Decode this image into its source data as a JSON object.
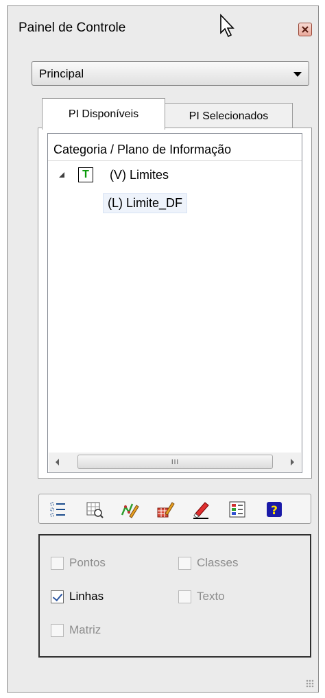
{
  "window": {
    "title": "Painel de Controle"
  },
  "dropdown": {
    "selected": "Principal"
  },
  "tabs": [
    {
      "label": "PI Disponíveis",
      "active": true
    },
    {
      "label": "PI Selecionados",
      "active": false
    }
  ],
  "tree": {
    "header": "Categoria / Plano de Informação",
    "category": {
      "icon": "theme-icon",
      "icon_letter": "T",
      "label": "(V) Limites",
      "expanded": true
    },
    "layer": {
      "label": "(L) Limite_DF",
      "selected": true
    },
    "scroll_grip": "III"
  },
  "toolbar": {
    "tools": [
      "list-icon",
      "zoom-layer-icon",
      "edit-vector-icon",
      "edit-raster-icon",
      "eraser-icon",
      "legend-icon",
      "help-icon"
    ]
  },
  "options": [
    {
      "label": "Pontos",
      "checked": false,
      "enabled": false
    },
    {
      "label": "Classes",
      "checked": false,
      "enabled": false
    },
    {
      "label": "Linhas",
      "checked": true,
      "enabled": true
    },
    {
      "label": "Texto",
      "checked": false,
      "enabled": false
    },
    {
      "label": "Matriz",
      "checked": false,
      "enabled": false
    }
  ],
  "colors": {
    "accent_check": "#2b55a0",
    "theme_icon_green": "#0a9a0a"
  }
}
